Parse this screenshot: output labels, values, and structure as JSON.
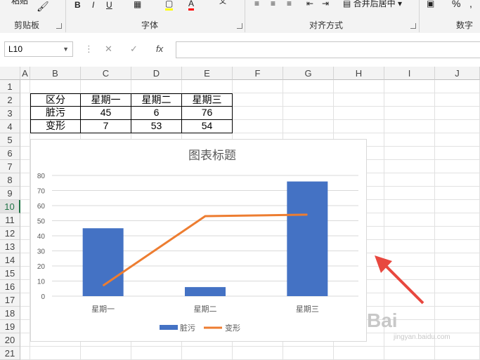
{
  "ribbon": {
    "groups": [
      {
        "label": "剪贴板"
      },
      {
        "label": "字体"
      },
      {
        "label": "对齐方式"
      },
      {
        "label": "数字"
      }
    ],
    "paste_label": "粘贴",
    "bold": "B",
    "italic": "I",
    "underline": "U",
    "font_color": "A",
    "merge_center": "合并后居中",
    "percent": "%",
    "comma": ","
  },
  "formula_bar": {
    "name_box": "L10",
    "formula": ""
  },
  "sheet": {
    "columns": [
      "A",
      "B",
      "C",
      "D",
      "E",
      "F",
      "G",
      "H",
      "I",
      "J"
    ],
    "rows": [
      "1",
      "2",
      "3",
      "4",
      "5",
      "6",
      "7",
      "8",
      "9",
      "10",
      "11",
      "12",
      "13",
      "14",
      "15",
      "16",
      "17",
      "18",
      "19",
      "20",
      "21"
    ],
    "active_row": "10",
    "table": [
      [
        "区分",
        "星期一",
        "星期二",
        "星期三"
      ],
      [
        "脏污",
        "45",
        "6",
        "76"
      ],
      [
        "变形",
        "7",
        "53",
        "54"
      ]
    ]
  },
  "chart_data": {
    "type": "bar",
    "title": "图表标题",
    "categories": [
      "星期一",
      "星期二",
      "星期三"
    ],
    "series": [
      {
        "name": "脏污",
        "type": "bar",
        "values": [
          45,
          6,
          76
        ],
        "color": "#4472c4"
      },
      {
        "name": "变形",
        "type": "line",
        "values": [
          7,
          53,
          54
        ],
        "color": "#ed7d31"
      }
    ],
    "ylim": [
      0,
      80
    ],
    "yticks": [
      "0",
      "10",
      "20",
      "30",
      "40",
      "50",
      "60",
      "70",
      "80"
    ],
    "grid": true,
    "legend": "bottom"
  },
  "watermark": {
    "brand": "Bai",
    "site": "jingyan.baidu.com"
  }
}
